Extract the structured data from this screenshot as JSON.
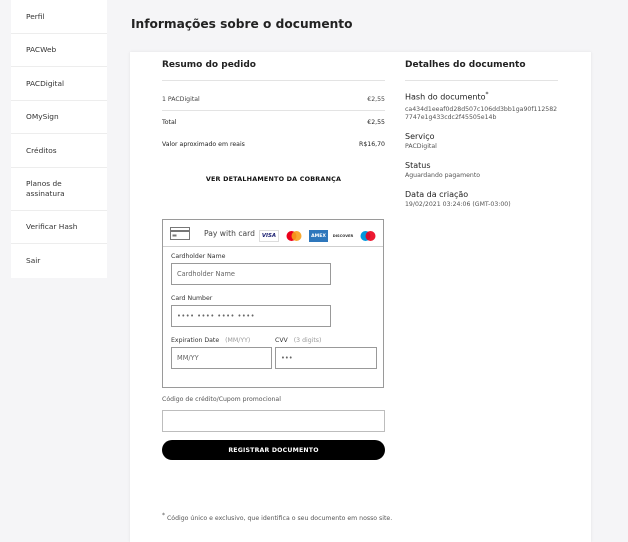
{
  "sidebar": {
    "items": [
      {
        "label": "Perfil"
      },
      {
        "label": "PACWeb"
      },
      {
        "label": "PACDigital"
      },
      {
        "label": "OMySign"
      },
      {
        "label": "Créditos"
      },
      {
        "label": "Planos de assinatura"
      },
      {
        "label": "Verificar Hash"
      },
      {
        "label": "Sair"
      }
    ]
  },
  "page": {
    "title": "Informações sobre o documento"
  },
  "order": {
    "title": "Resumo do pedido",
    "item_label": "1 PACDigital",
    "item_price": "€2,55",
    "total_label": "Total",
    "total_value": "€2,55",
    "brl_label": "Valor aproximado em reais",
    "brl_value": "R$16,70",
    "detail_link": "VER DETALHAMENTO DA COBRANÇA"
  },
  "payment": {
    "pay_with_card": "Pay with card",
    "brands": [
      "visa",
      "mastercard",
      "amex",
      "discover",
      "maestro"
    ],
    "brand_labels": {
      "visa": "VISA",
      "amex": "AMEX",
      "discover": "DISCOVER"
    },
    "cardholder_label": "Cardholder Name",
    "cardholder_placeholder": "Cardholder Name",
    "cardnumber_label": "Card Number",
    "cardnumber_placeholder": "•••• •••• •••• ••••",
    "expiration_label": "Expiration Date",
    "expiration_hint": "(MM/YY)",
    "expiration_placeholder": "MM/YY",
    "cvv_label": "CVV",
    "cvv_hint": "(3 digits)",
    "cvv_placeholder": "•••"
  },
  "promo": {
    "label": "Código de crédito/Cupom promocional",
    "value": ""
  },
  "submit_label": "REGISTRAR DOCUMENTO",
  "details": {
    "title": "Detalhes do documento",
    "hash_label": "Hash do documento",
    "hash_marker": "*",
    "hash_line1": "ca434d1eeaf0d28d507c106dd3bb1ga90f112582",
    "hash_line2": "7747e1g433cdc2f45505e14b",
    "service_label": "Serviço",
    "service_value": "PACDigital",
    "status_label": "Status",
    "status_value": "Aguardando pagamento",
    "created_label": "Data da criação",
    "created_value": "19/02/2021 03:24:06 (GMT-03:00)"
  },
  "footnote": {
    "marker": "*",
    "text": "Código único e exclusivo, que identifica o seu documento em nosso site."
  },
  "colors": {
    "visa": "#1a1f71",
    "mastercard_red": "#eb001b",
    "mastercard_orange": "#f79e1b",
    "amex": "#2e77bc",
    "discover": "#f38120",
    "maestro_blue": "#0099df"
  }
}
